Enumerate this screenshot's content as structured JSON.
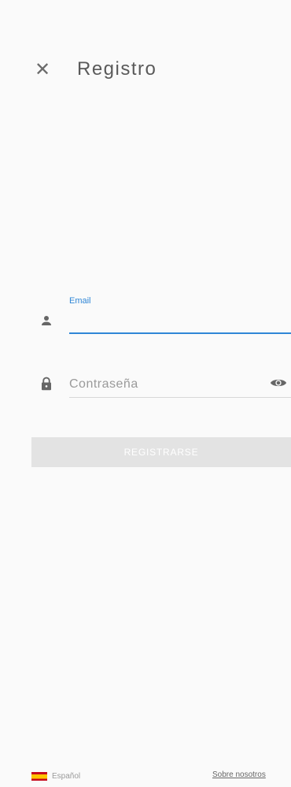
{
  "header": {
    "title": "Registro",
    "close_icon": "close-icon"
  },
  "form": {
    "email": {
      "label": "Email",
      "value": "",
      "icon": "person-icon"
    },
    "password": {
      "placeholder": "Contraseña",
      "value": "",
      "icon": "lock-icon",
      "toggle_icon": "eye-icon"
    },
    "submit_label": "REGISTRARSE"
  },
  "footer": {
    "language": "Español",
    "language_icon": "spain-flag-icon",
    "about_link": "Sobre nosotros"
  },
  "colors": {
    "accent": "#2f86d6",
    "background": "#fafafa",
    "button_disabled": "#e3e3e3",
    "text": "#5a5a5a"
  }
}
